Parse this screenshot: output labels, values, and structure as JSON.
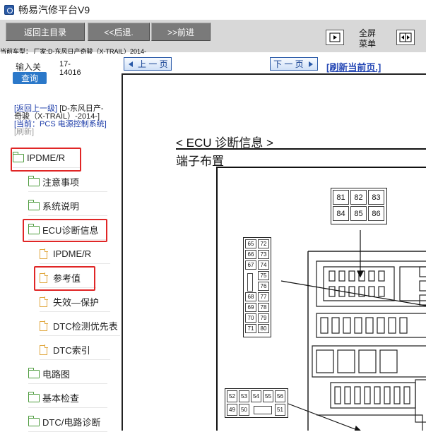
{
  "window": {
    "title": "畅易汽修平台V9"
  },
  "toolbar": {
    "home_label": "返回主目录",
    "back_label": "<<后退.",
    "forward_label": ">>前进",
    "fullscreen_menu_line1": "全屏",
    "fullscreen_menu_line2": "菜单"
  },
  "vehicle_line": "当前车型： 厂家:D-东风日产奇骏（X-TRAIL）2014-",
  "sidebar": {
    "input_label": "输入关",
    "code_line1": "17-",
    "code_line2": "14016",
    "query_label": "查询",
    "return_link": "[返回上一级]",
    "parent_text": "[D-东风日产-奇骏（X-TRAIL）-2014-]",
    "current_text": "[当前：PCS 电源控制系统]",
    "refresh_text": "[刷新]",
    "tree": [
      {
        "label": "IPDME/R",
        "type": "folder"
      },
      {
        "label": "注意事项",
        "type": "folder"
      },
      {
        "label": "系统说明",
        "type": "folder"
      },
      {
        "label": "ECU诊断信息",
        "type": "folder"
      },
      {
        "label": "IPDME/R",
        "type": "doc"
      },
      {
        "label": "参考值",
        "type": "doc"
      },
      {
        "label": "失效—保护",
        "type": "doc"
      },
      {
        "label": "DTC检测优先表",
        "type": "doc"
      },
      {
        "label": "DTC索引",
        "type": "doc"
      },
      {
        "label": "电路图",
        "type": "folder"
      },
      {
        "label": "基本检查",
        "type": "folder"
      },
      {
        "label": "DTC/电路诊断",
        "type": "folder"
      }
    ]
  },
  "pager": {
    "prev_label": "上 一 页",
    "next_label": "下 一 页",
    "refresh_label": "[刷新当前页.]"
  },
  "document": {
    "section_title": "< ECU 诊断信息 >",
    "subsection_title": "端子布置",
    "connector_top": [
      "81",
      "82",
      "83",
      "84",
      "85",
      "86"
    ],
    "connector_left": [
      "65",
      "72",
      "66",
      "73",
      "67",
      "74",
      "75",
      "76",
      "68",
      "77",
      "69",
      "78",
      "70",
      "79",
      "71",
      "80"
    ],
    "connector_bottom": [
      "52",
      "53",
      "54",
      "55",
      "56",
      "49",
      "50",
      "51"
    ]
  },
  "colors": {
    "highlight": "#e02626",
    "link": "#1a3aa8",
    "folder": "#4c9a3c",
    "doc": "#e0a63c"
  }
}
